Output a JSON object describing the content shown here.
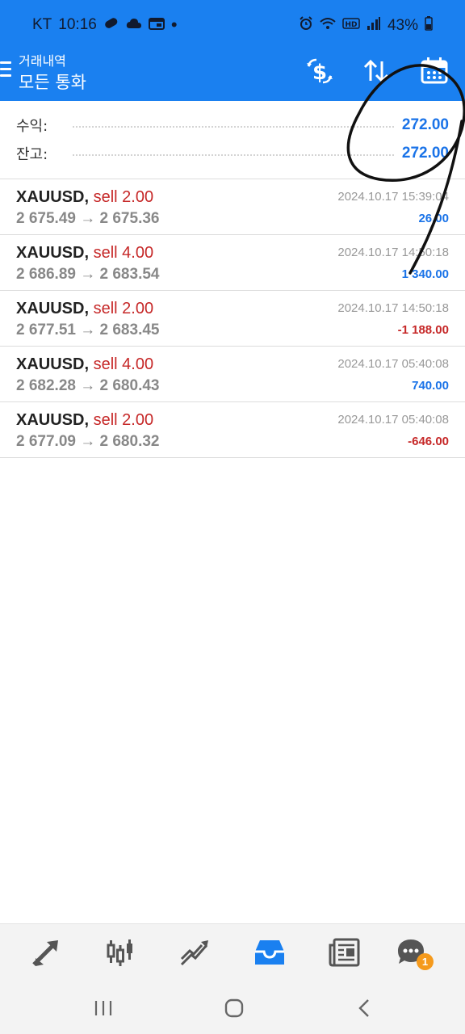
{
  "status_bar": {
    "carrier": "KT",
    "time": "10:16",
    "battery": "43%",
    "icons_left": [
      "link-icon",
      "cloud-icon",
      "calendar-card-icon",
      "dot-icon"
    ],
    "icons_right": [
      "alarm-icon",
      "wifi-icon",
      "hd-icon",
      "signal-icon",
      "battery-icon"
    ]
  },
  "header": {
    "title_small": "거래내역",
    "title_large": "모든 통화",
    "icons": [
      "currency-exchange-icon",
      "sort-icon",
      "calendar-icon"
    ]
  },
  "summary": {
    "profit_label": "수익:",
    "profit_value": "272.00",
    "balance_label": "잔고:",
    "balance_value": "272.00"
  },
  "trades": [
    {
      "symbol": "XAUUSD,",
      "side": "sell 2.00",
      "prices": "2 675.49 → 2 675.36",
      "time": "2024.10.17 15:39:04",
      "pl": "26.00",
      "pl_sign": "pos"
    },
    {
      "symbol": "XAUUSD,",
      "side": "sell 4.00",
      "prices": "2 686.89 → 2 683.54",
      "time": "2024.10.17 14:50:18",
      "pl": "1 340.00",
      "pl_sign": "pos"
    },
    {
      "symbol": "XAUUSD,",
      "side": "sell 2.00",
      "prices": "2 677.51 → 2 683.45",
      "time": "2024.10.17 14:50:18",
      "pl": "-1 188.00",
      "pl_sign": "neg"
    },
    {
      "symbol": "XAUUSD,",
      "side": "sell 4.00",
      "prices": "2 682.28 → 2 680.43",
      "time": "2024.10.17 05:40:08",
      "pl": "740.00",
      "pl_sign": "pos"
    },
    {
      "symbol": "XAUUSD,",
      "side": "sell 2.00",
      "prices": "2 677.09 → 2 680.32",
      "time": "2024.10.17 05:40:08",
      "pl": "-646.00",
      "pl_sign": "neg"
    }
  ],
  "tabbar": {
    "tabs": [
      "quotes-icon",
      "chart-icon",
      "trade-icon",
      "history-icon",
      "news-icon",
      "messages-icon"
    ],
    "active": "history-icon",
    "messages_badge": "1"
  },
  "navbar": {
    "buttons": [
      "recent-apps-icon",
      "home-icon",
      "back-icon"
    ]
  },
  "colors": {
    "accent": "#1a80f0",
    "positive": "#1a73e8",
    "negative": "#c62828"
  }
}
